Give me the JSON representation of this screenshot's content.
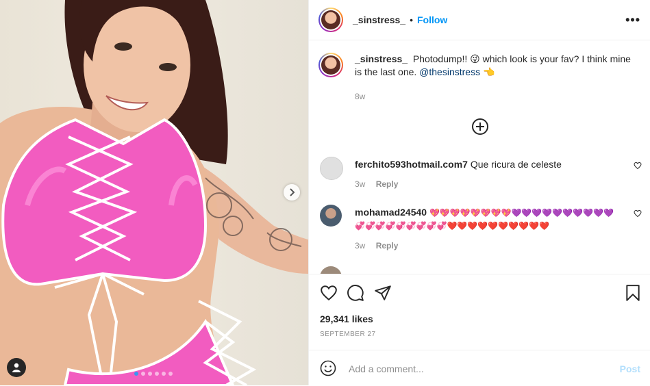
{
  "post": {
    "username": "_sinstress_",
    "separator": "•",
    "follow_label": "Follow",
    "more_label": "•••"
  },
  "caption": {
    "username": "_sinstress_",
    "text": "Photodump!! 😜 which look is your fav? I think mine is the last one. ",
    "mention": "@thesinstress",
    "trail": " 👈",
    "time": "8w"
  },
  "comments": [
    {
      "username": "ferchito593hotmail.com7",
      "text": "Que ricura de celeste",
      "time": "3w",
      "reply_label": "Reply"
    },
    {
      "username": "mohamad24540",
      "text": "💖💖💖💖💖💖💖💖💜💜💜💜💜💜💜💜💜💜💞💞💞💞💞💞💞💞💞❤️❤️❤️❤️❤️❤️❤️❤️❤️❤️",
      "time": "3w",
      "reply_label": "Reply"
    }
  ],
  "likes_text": "29,341 likes",
  "date_text": "SEPTEMBER 27",
  "add_comment": {
    "placeholder": "Add a comment...",
    "post_label": "Post"
  },
  "carousel": {
    "slide_count": 6,
    "active_index": 0
  },
  "colors": {
    "accent": "#0095f6",
    "swimsuit": "#f25cc0",
    "post_disabled": "#b2dffc"
  },
  "icons": [
    "chevron-right-icon",
    "user-tag-icon",
    "more-icon",
    "add-circle-icon",
    "heart-icon",
    "comment-icon",
    "share-icon",
    "bookmark-icon",
    "emoji-icon"
  ]
}
